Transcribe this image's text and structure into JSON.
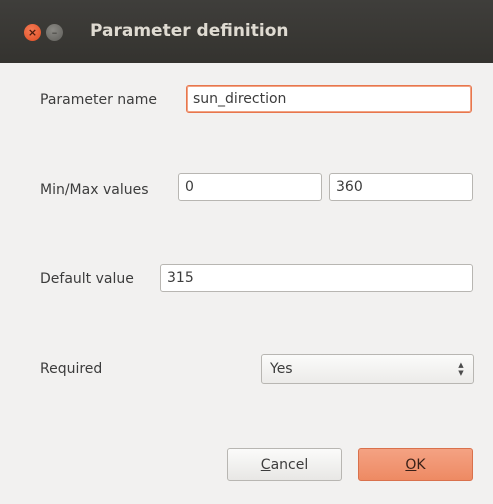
{
  "window": {
    "title": "Parameter definition",
    "close_glyph": "×",
    "minimize_glyph": "–"
  },
  "form": {
    "parameter_name": {
      "label": "Parameter name",
      "value": "sun_direction"
    },
    "min_max": {
      "label": "Min/Max values",
      "min_value": "0",
      "max_value": "360"
    },
    "default_value": {
      "label": "Default value",
      "value": "315"
    },
    "required": {
      "label": "Required",
      "selected": "Yes"
    }
  },
  "buttons": {
    "cancel": {
      "mnemonic": "C",
      "rest": "ancel"
    },
    "ok": {
      "mnemonic": "O",
      "rest": "K"
    }
  },
  "colors": {
    "titlebar": "#3f3e3b",
    "close_button": "#e95420",
    "focus_accent": "#e8764d",
    "ok_button": "#ef8b65",
    "dialog_background": "#f2f1f0"
  },
  "icons": {
    "close": "close-icon",
    "minimize": "minimize-icon",
    "spinner": "up-down-arrows-icon"
  }
}
